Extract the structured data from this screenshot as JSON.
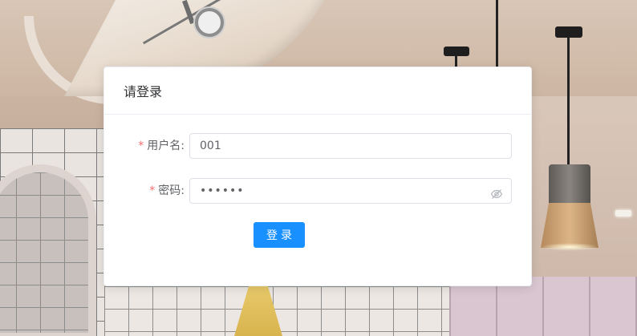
{
  "card": {
    "title": "请登录"
  },
  "form": {
    "username": {
      "required_mark": "*",
      "label": "用户名:",
      "value": "001"
    },
    "password": {
      "required_mark": "*",
      "label": "密码:",
      "masked_value": "••••••",
      "toggle_icon": "eye-off-icon"
    },
    "submit_label": "登录"
  },
  "colors": {
    "primary": "#1890ff",
    "required": "#f56c6c",
    "card_bg": "#ffffff",
    "border": "#dcdfe6"
  }
}
